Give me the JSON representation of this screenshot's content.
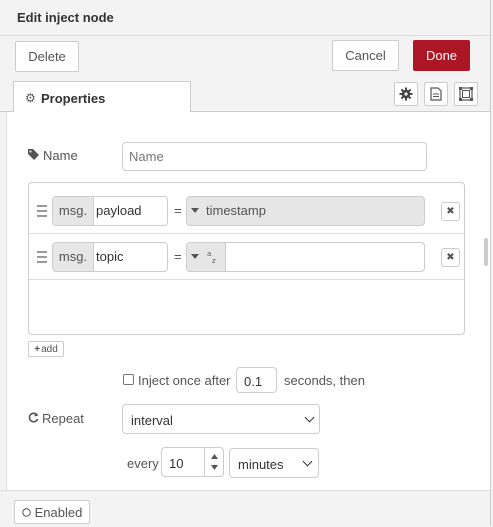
{
  "window": {
    "title": "Edit inject node"
  },
  "toolbar": {
    "delete_label": "Delete",
    "cancel_label": "Cancel",
    "done_label": "Done"
  },
  "tabs": {
    "properties_label": "Properties"
  },
  "form": {
    "name_label": "Name",
    "name_placeholder": "Name",
    "rows": [
      {
        "prefix": "msg.",
        "property": "payload",
        "equals": "=",
        "type_label": "timestamp"
      },
      {
        "prefix": "msg.",
        "property": "topic",
        "equals": "=",
        "type_label": ""
      }
    ],
    "add_label": "add",
    "inject_once_label": "Inject once after",
    "inject_once_value": "0.1",
    "seconds_label": "seconds, then",
    "repeat_label": "Repeat",
    "repeat_value": "interval",
    "every_label": "every",
    "every_value": "10",
    "unit_value": "minutes"
  },
  "footer": {
    "enabled_label": "Enabled"
  }
}
